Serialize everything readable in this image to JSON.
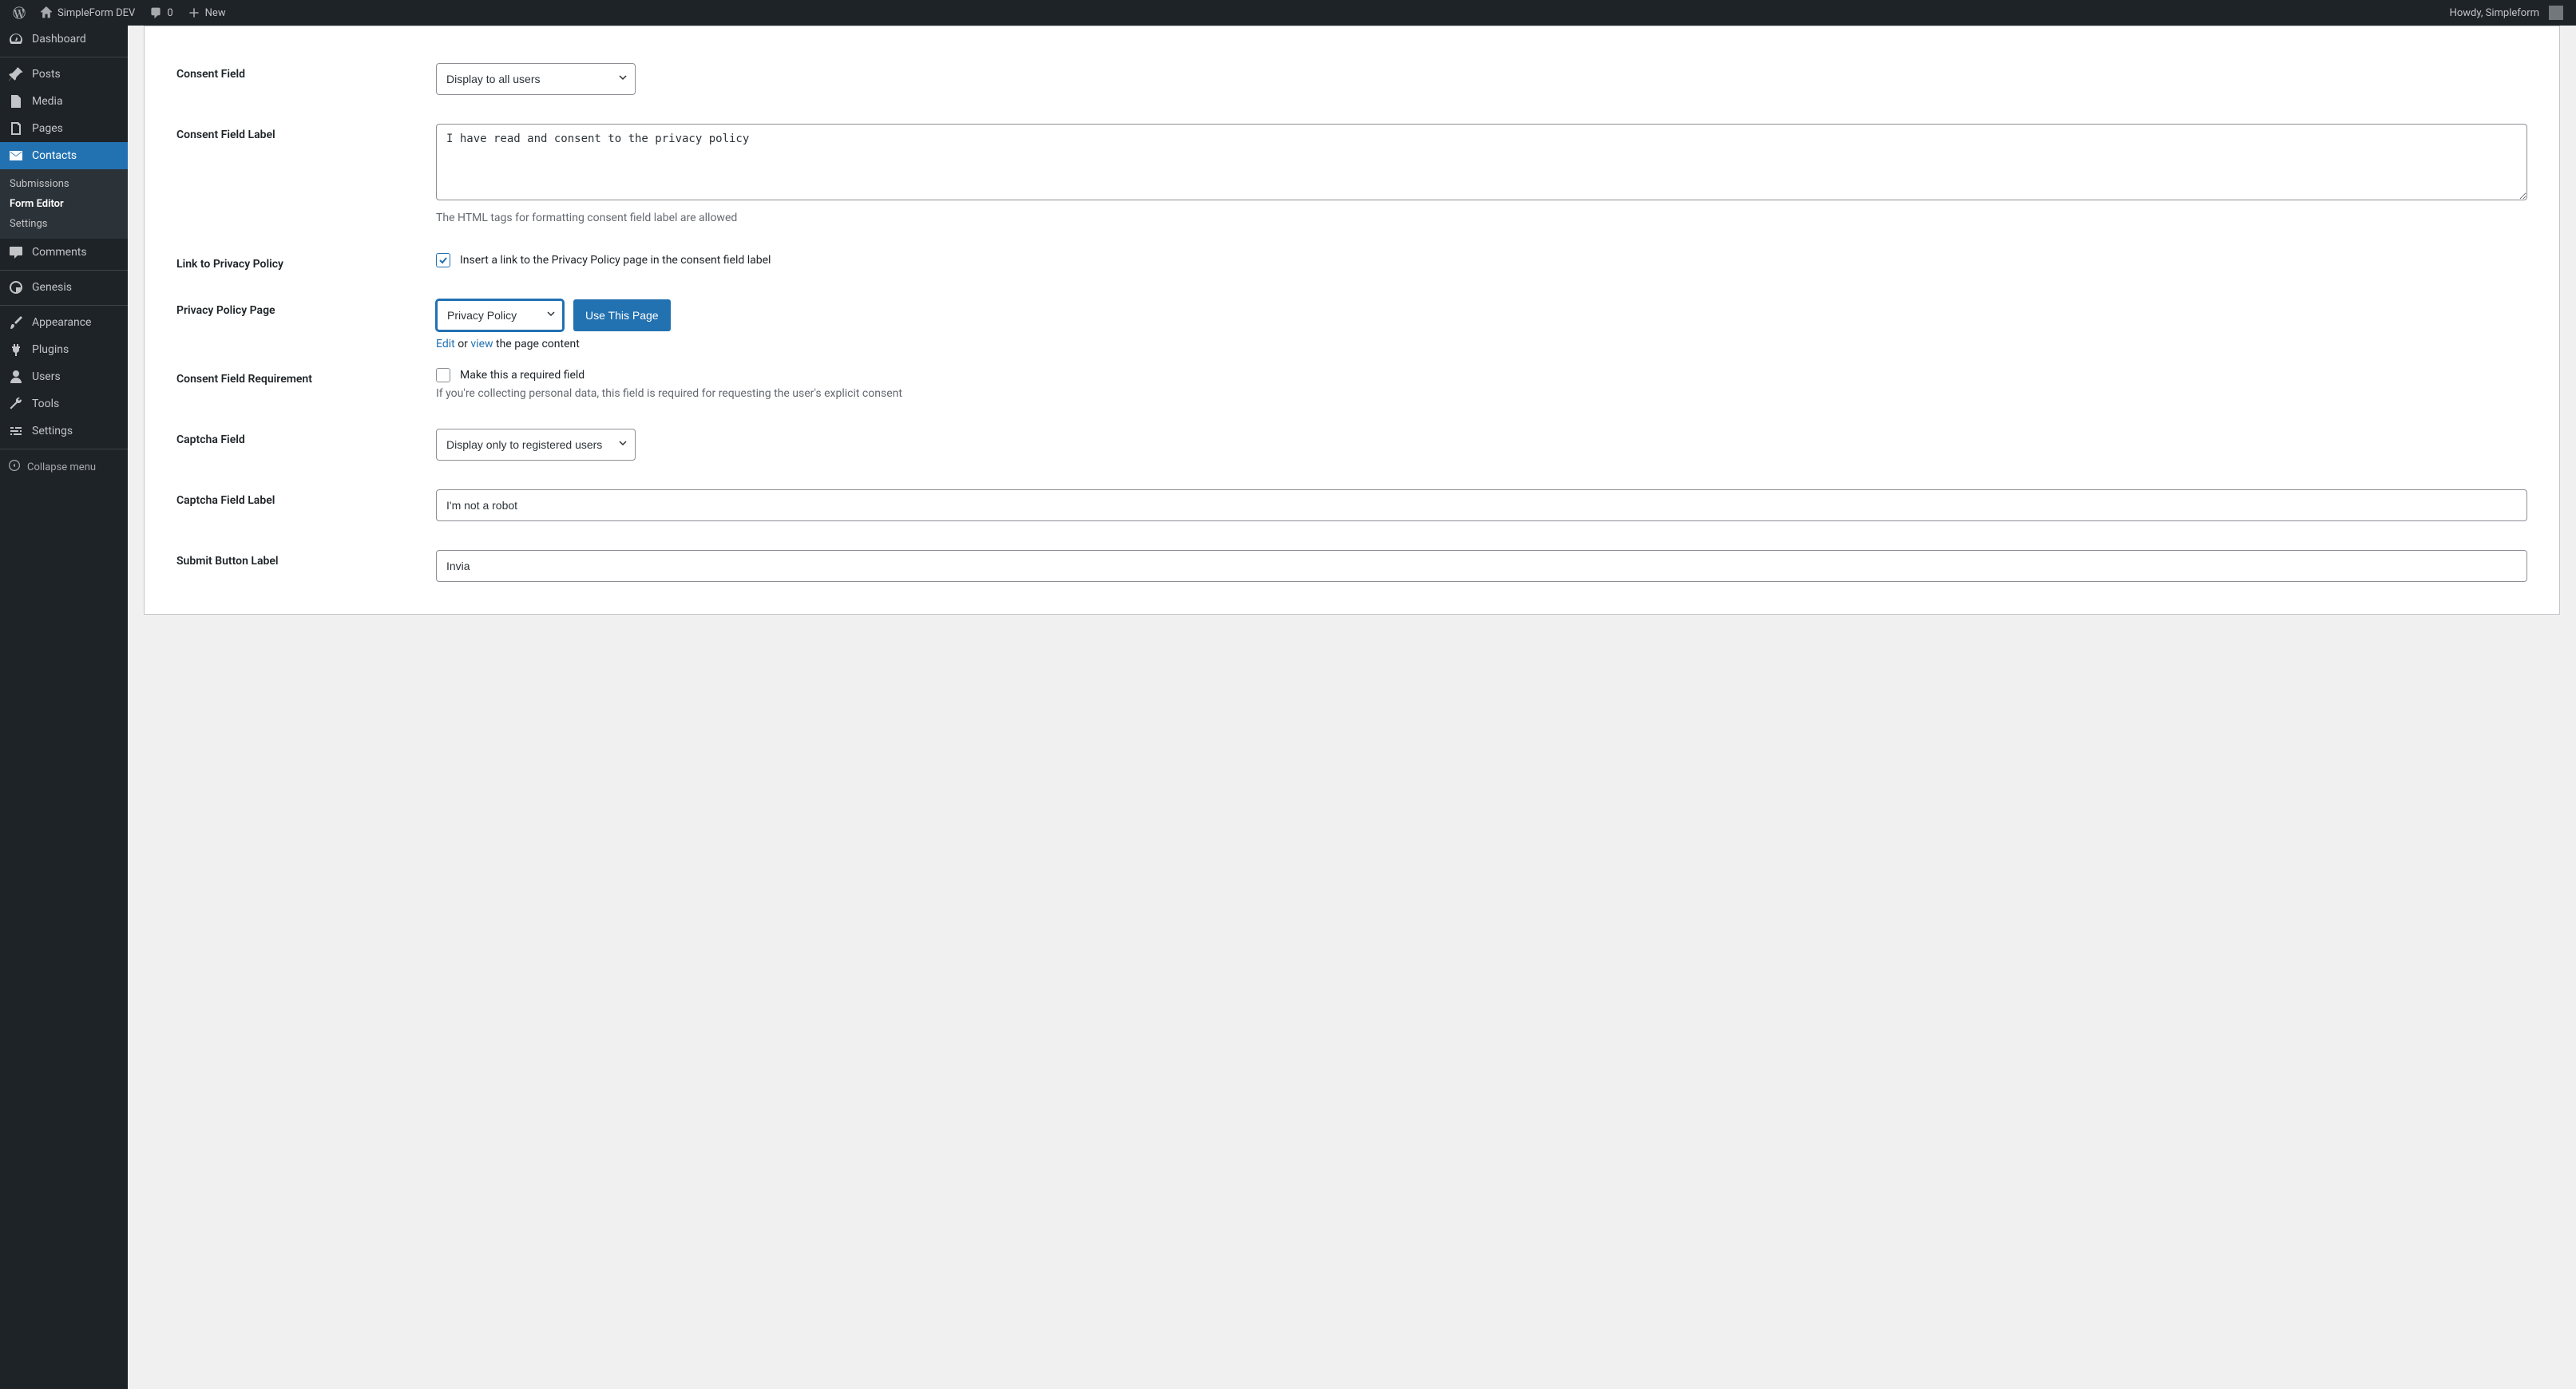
{
  "adminbar": {
    "site_name": "SimpleForm DEV",
    "comments_count": "0",
    "new_label": "New",
    "howdy": "Howdy, Simpleform"
  },
  "sidebar": {
    "items": [
      {
        "label": "Dashboard"
      },
      {
        "label": "Posts"
      },
      {
        "label": "Media"
      },
      {
        "label": "Pages"
      },
      {
        "label": "Contacts"
      },
      {
        "label": "Comments"
      },
      {
        "label": "Genesis"
      },
      {
        "label": "Appearance"
      },
      {
        "label": "Plugins"
      },
      {
        "label": "Users"
      },
      {
        "label": "Tools"
      },
      {
        "label": "Settings"
      }
    ],
    "submenu": [
      {
        "label": "Submissions"
      },
      {
        "label": "Form Editor"
      },
      {
        "label": "Settings"
      }
    ],
    "collapse": "Collapse menu"
  },
  "form": {
    "consent_field": {
      "label": "Consent Field",
      "value": "Display to all users"
    },
    "consent_field_label": {
      "label": "Consent Field Label",
      "value": "I have read and consent to the privacy policy",
      "help": "The HTML tags for formatting consent field label are allowed"
    },
    "link_privacy": {
      "label": "Link to Privacy Policy",
      "checkbox_label": "Insert a link to the Privacy Policy page in the consent field label",
      "checked": true
    },
    "privacy_page": {
      "label": "Privacy Policy Page",
      "value": "Privacy Policy",
      "button": "Use This Page",
      "edit": "Edit",
      "or": " or ",
      "view": "view",
      "tail": " the page content"
    },
    "consent_req": {
      "label": "Consent Field Requirement",
      "checkbox_label": "Make this a required field",
      "help": "If you're collecting personal data, this field is required for requesting the user's explicit consent"
    },
    "captcha_field": {
      "label": "Captcha Field",
      "value": "Display only to registered users"
    },
    "captcha_label": {
      "label": "Captcha Field Label",
      "value": "I'm not a robot"
    },
    "submit_label": {
      "label": "Submit Button Label",
      "value": "Invia"
    }
  }
}
